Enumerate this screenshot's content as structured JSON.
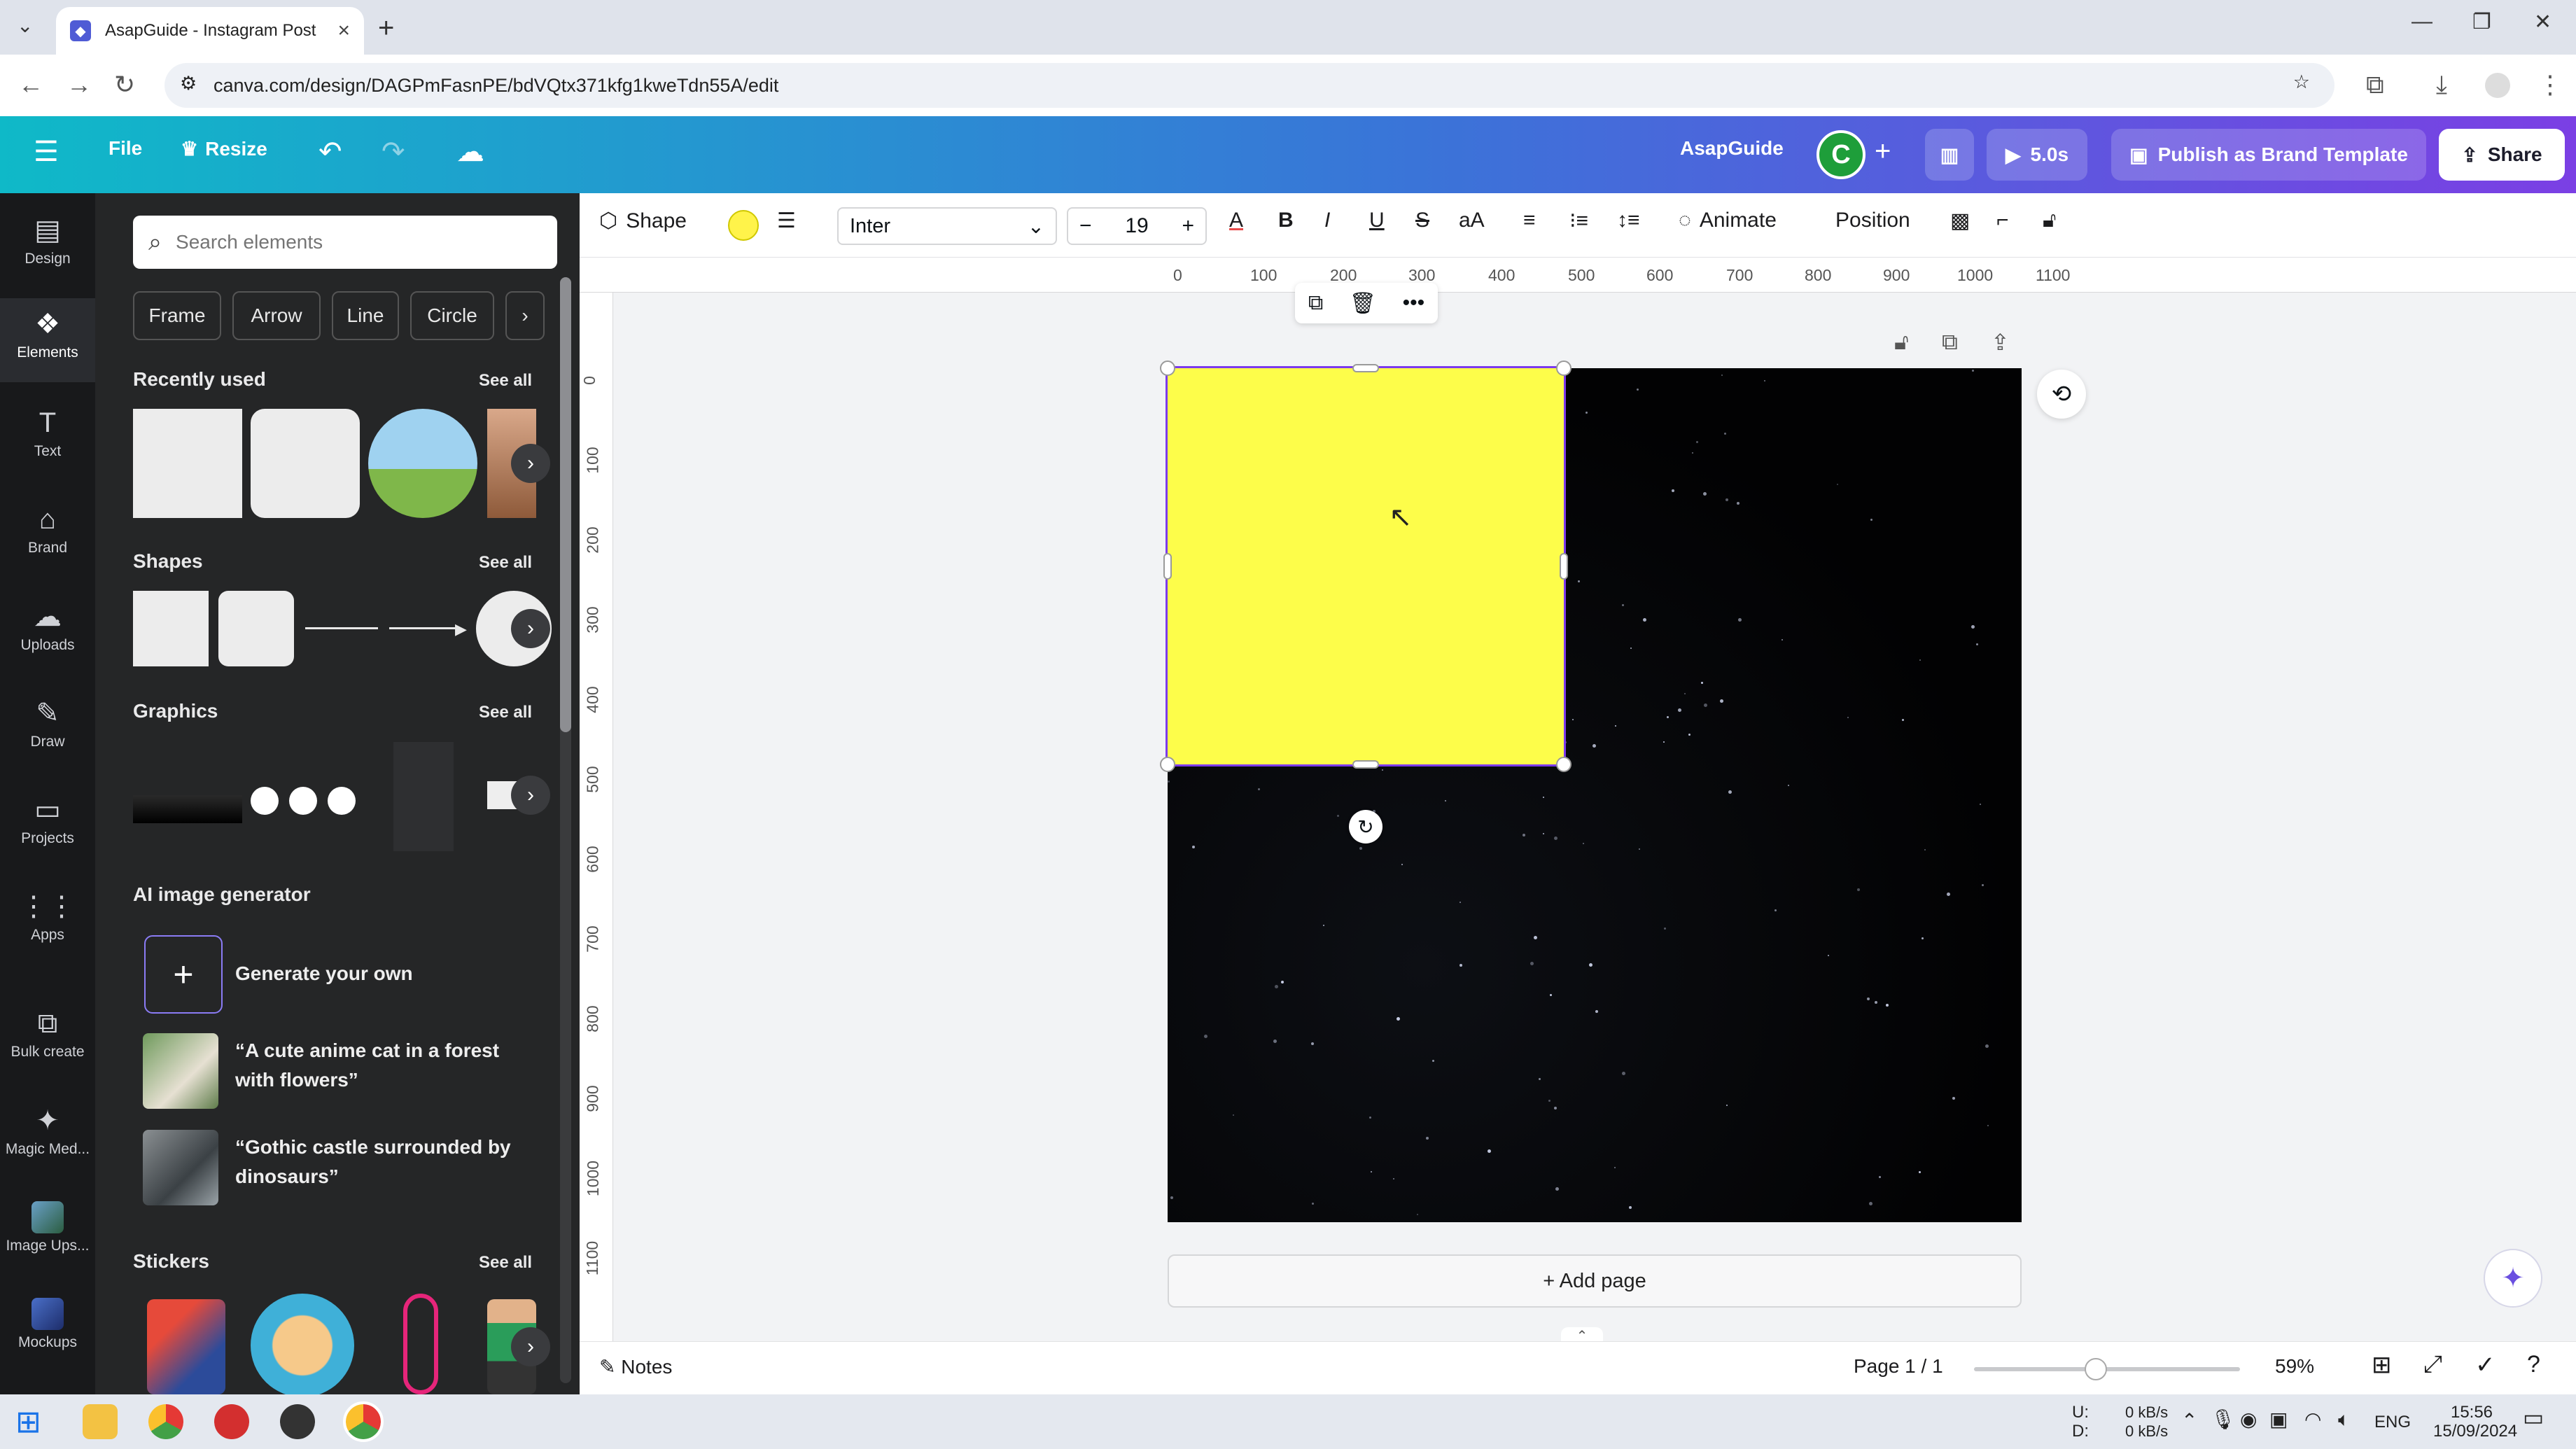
{
  "browser": {
    "tab_title": "AsapGuide - Instagram Post",
    "url": "canva.com/design/DAGPmFasnPE/bdVQtx371kfg1kweTdn55A/edit"
  },
  "header": {
    "file": "File",
    "resize": "Resize",
    "team": "AsapGuide",
    "avatar_letter": "C",
    "duration": "5.0s",
    "publish": "Publish as Brand Template",
    "share": "Share"
  },
  "rail": {
    "design": "Design",
    "elements": "Elements",
    "text": "Text",
    "brand": "Brand",
    "uploads": "Uploads",
    "draw": "Draw",
    "projects": "Projects",
    "apps": "Apps",
    "bulk": "Bulk create",
    "magic": "Magic Med...",
    "upscaler": "Image Ups...",
    "mockups": "Mockups"
  },
  "panel": {
    "search_placeholder": "Search elements",
    "chips": [
      "Frame",
      "Arrow",
      "Line",
      "Circle"
    ],
    "recently_used": "Recently used",
    "shapes": "Shapes",
    "graphics": "Graphics",
    "ai_generator": "AI image generator",
    "generate": "Generate your own",
    "prompt1": "“A cute anime cat in a forest with flowers”",
    "prompt2": "“Gothic castle surrounded by dinosaurs”",
    "stickers": "Stickers",
    "see_all": "See all"
  },
  "toolbar": {
    "shape": "Shape",
    "font": "Inter",
    "font_size": "19",
    "animate": "Animate",
    "position": "Position"
  },
  "ruler": {
    "h": [
      "0",
      "100",
      "200",
      "300",
      "400",
      "500",
      "600",
      "700",
      "800",
      "900",
      "1000",
      "1100"
    ],
    "v": [
      "0",
      "100",
      "200",
      "300",
      "400",
      "500",
      "600",
      "700",
      "800",
      "900",
      "1000",
      "1100"
    ]
  },
  "canvas": {
    "add_page": "+ Add page",
    "fill_color": "#fdfd4a"
  },
  "footer": {
    "notes": "Notes",
    "page": "Page 1 / 1",
    "zoom": "59%"
  },
  "taskbar": {
    "net_up": "0 kB/s",
    "net_down": "0 kB/s",
    "net_u": "U:",
    "net_d": "D:",
    "lang": "ENG",
    "time": "15:56",
    "date": "15/09/2024"
  }
}
